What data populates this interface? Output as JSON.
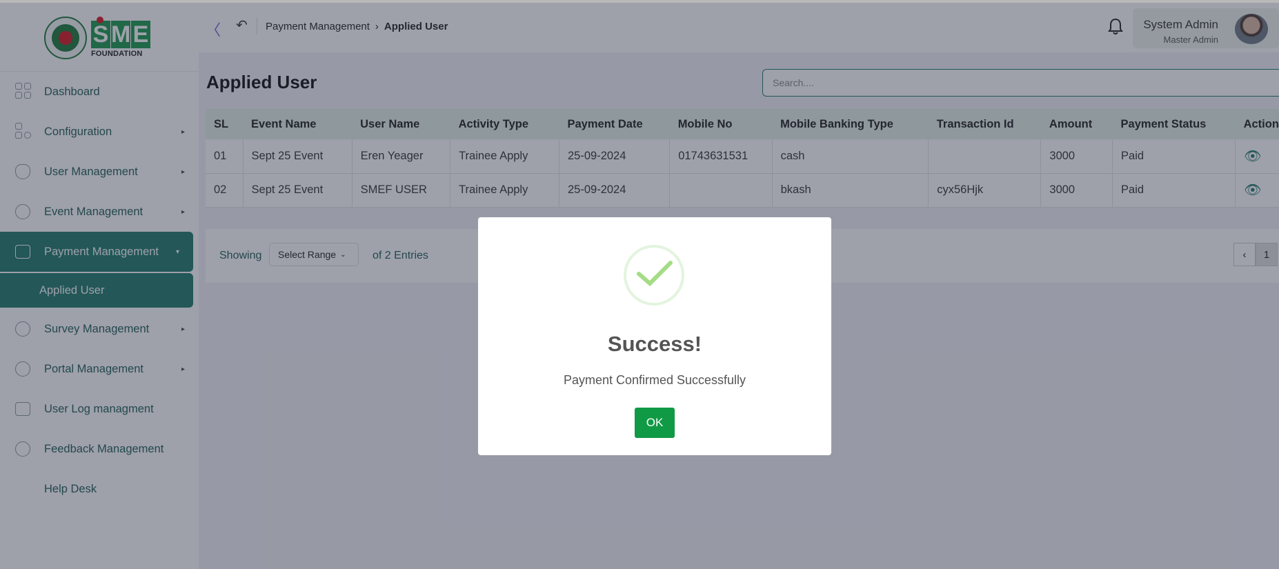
{
  "brand": {
    "logo_text": "SME",
    "logo_subtitle": "FOUNDATION"
  },
  "sidebar": {
    "items": [
      {
        "label": "Dashboard",
        "icon": "grid-icon",
        "has_caret": false
      },
      {
        "label": "Configuration",
        "icon": "config-icon",
        "has_caret": true
      },
      {
        "label": "User Management",
        "icon": "shield-icon",
        "has_caret": true
      },
      {
        "label": "Event Management",
        "icon": "event-icon",
        "has_caret": true
      },
      {
        "label": "Payment Management",
        "icon": "wallet-icon",
        "has_caret": true,
        "active": true
      },
      {
        "label": "Survey Management",
        "icon": "chart-icon",
        "has_caret": true
      },
      {
        "label": "Portal Management",
        "icon": "portal-icon",
        "has_caret": true
      },
      {
        "label": "User Log managment",
        "icon": "log-icon",
        "has_caret": false
      },
      {
        "label": "Feedback Management",
        "icon": "feedback-icon",
        "has_caret": false
      },
      {
        "label": "Help Desk",
        "icon": "",
        "has_caret": false
      }
    ],
    "sub_item": "Applied User"
  },
  "header": {
    "breadcrumb": {
      "parent": "Payment Management",
      "current": "Applied User"
    },
    "user": {
      "name": "System Admin",
      "role": "Master Admin"
    }
  },
  "main": {
    "title": "Applied User",
    "search_placeholder": "Search....",
    "table": {
      "columns": [
        "SL",
        "Event Name",
        "User Name",
        "Activity Type",
        "Payment Date",
        "Mobile No",
        "Mobile Banking Type",
        "Transaction Id",
        "Amount",
        "Payment Status",
        "Action"
      ],
      "rows": [
        [
          "01",
          "Sept 25 Event",
          "Eren Yeager",
          "Trainee Apply",
          "25-09-2024",
          "01743631531",
          "cash",
          "",
          "3000",
          "Paid"
        ],
        [
          "02",
          "Sept 25 Event",
          "SMEF USER",
          "Trainee Apply",
          "25-09-2024",
          "",
          "bkash",
          "cyx56Hjk",
          "3000",
          "Paid"
        ]
      ]
    },
    "footer": {
      "showing": "Showing",
      "range": "Select Range",
      "entries": "of 2 Entries",
      "page": "1"
    }
  },
  "modal": {
    "title": "Success!",
    "text": "Payment Confirmed Successfully",
    "ok_label": "OK"
  },
  "colors": {
    "accent": "#1f7a6a",
    "success": "#109a45",
    "header_bg": "#e3f1e7"
  }
}
